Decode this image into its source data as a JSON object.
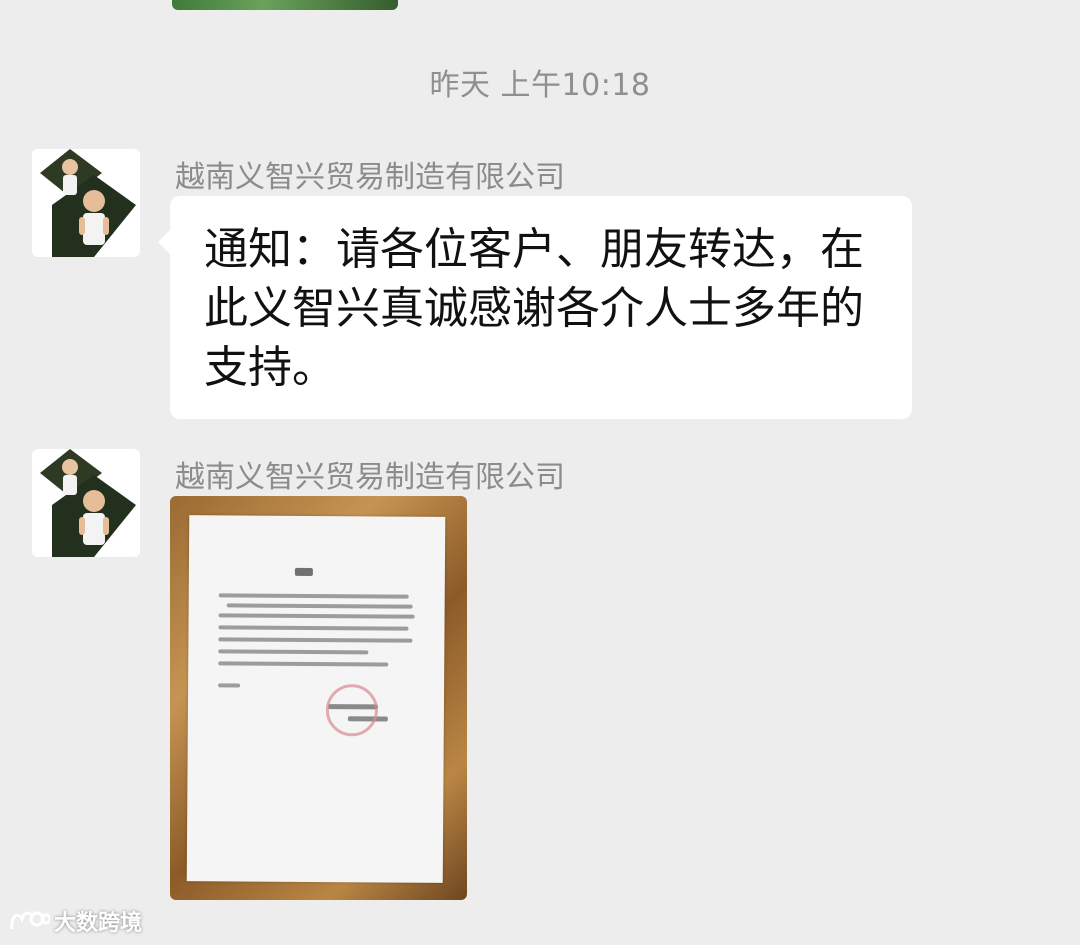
{
  "chat": {
    "timestamp": "昨天 上午10:18",
    "messages": [
      {
        "sender": "越南义智兴贸易制造有限公司",
        "text": "通知：请各位客户、朋友转达，在此义智兴真诚感谢各介人士多年的支持。"
      },
      {
        "sender": "越南义智兴贸易制造有限公司",
        "image": "photo-of-notice-document"
      }
    ]
  },
  "watermark": {
    "text": "大数跨境"
  },
  "colors": {
    "background": "#ededed",
    "bubble": "#ffffff",
    "meta_text": "#8c8c8c"
  }
}
